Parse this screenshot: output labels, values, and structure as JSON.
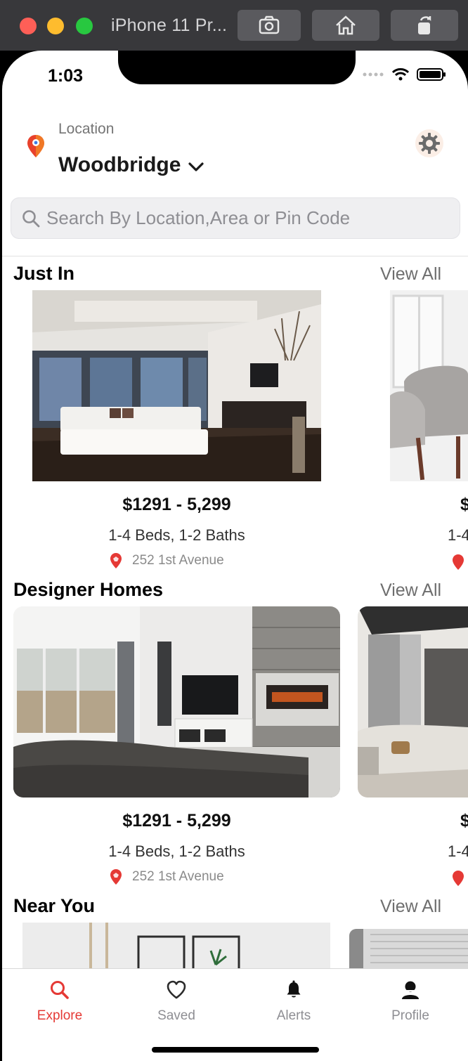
{
  "simulator": {
    "title": "iPhone 11 Pr..."
  },
  "status": {
    "time": "1:03"
  },
  "header": {
    "location_label": "Location",
    "location_value": "Woodbridge"
  },
  "search": {
    "placeholder": "Search By Location,Area or Pin Code"
  },
  "sections": [
    {
      "title": "Just In",
      "view_all": "View All",
      "cards": [
        {
          "price": "$1291 - 5,299",
          "beds": "1-4 Beds, 1-2 Baths",
          "address": "252 1st Avenue"
        },
        {
          "price": "$",
          "beds": "1-4",
          "address": ""
        }
      ]
    },
    {
      "title": "Designer Homes",
      "view_all": "View All",
      "cards": [
        {
          "price": "$1291 - 5,299",
          "beds": "1-4 Beds, 1-2 Baths",
          "address": "252 1st Avenue"
        },
        {
          "price": "$",
          "beds": "1-4",
          "address": ""
        }
      ]
    },
    {
      "title": "Near You",
      "view_all": "View All"
    }
  ],
  "tabs": [
    {
      "label": "Explore",
      "icon": "search-icon",
      "active": true
    },
    {
      "label": "Saved",
      "icon": "heart-icon",
      "active": false
    },
    {
      "label": "Alerts",
      "icon": "bell-icon",
      "active": false
    },
    {
      "label": "Profile",
      "icon": "user-icon",
      "active": false
    }
  ],
  "colors": {
    "accent": "#e53935",
    "tab_inactive": "#8e8e93"
  }
}
